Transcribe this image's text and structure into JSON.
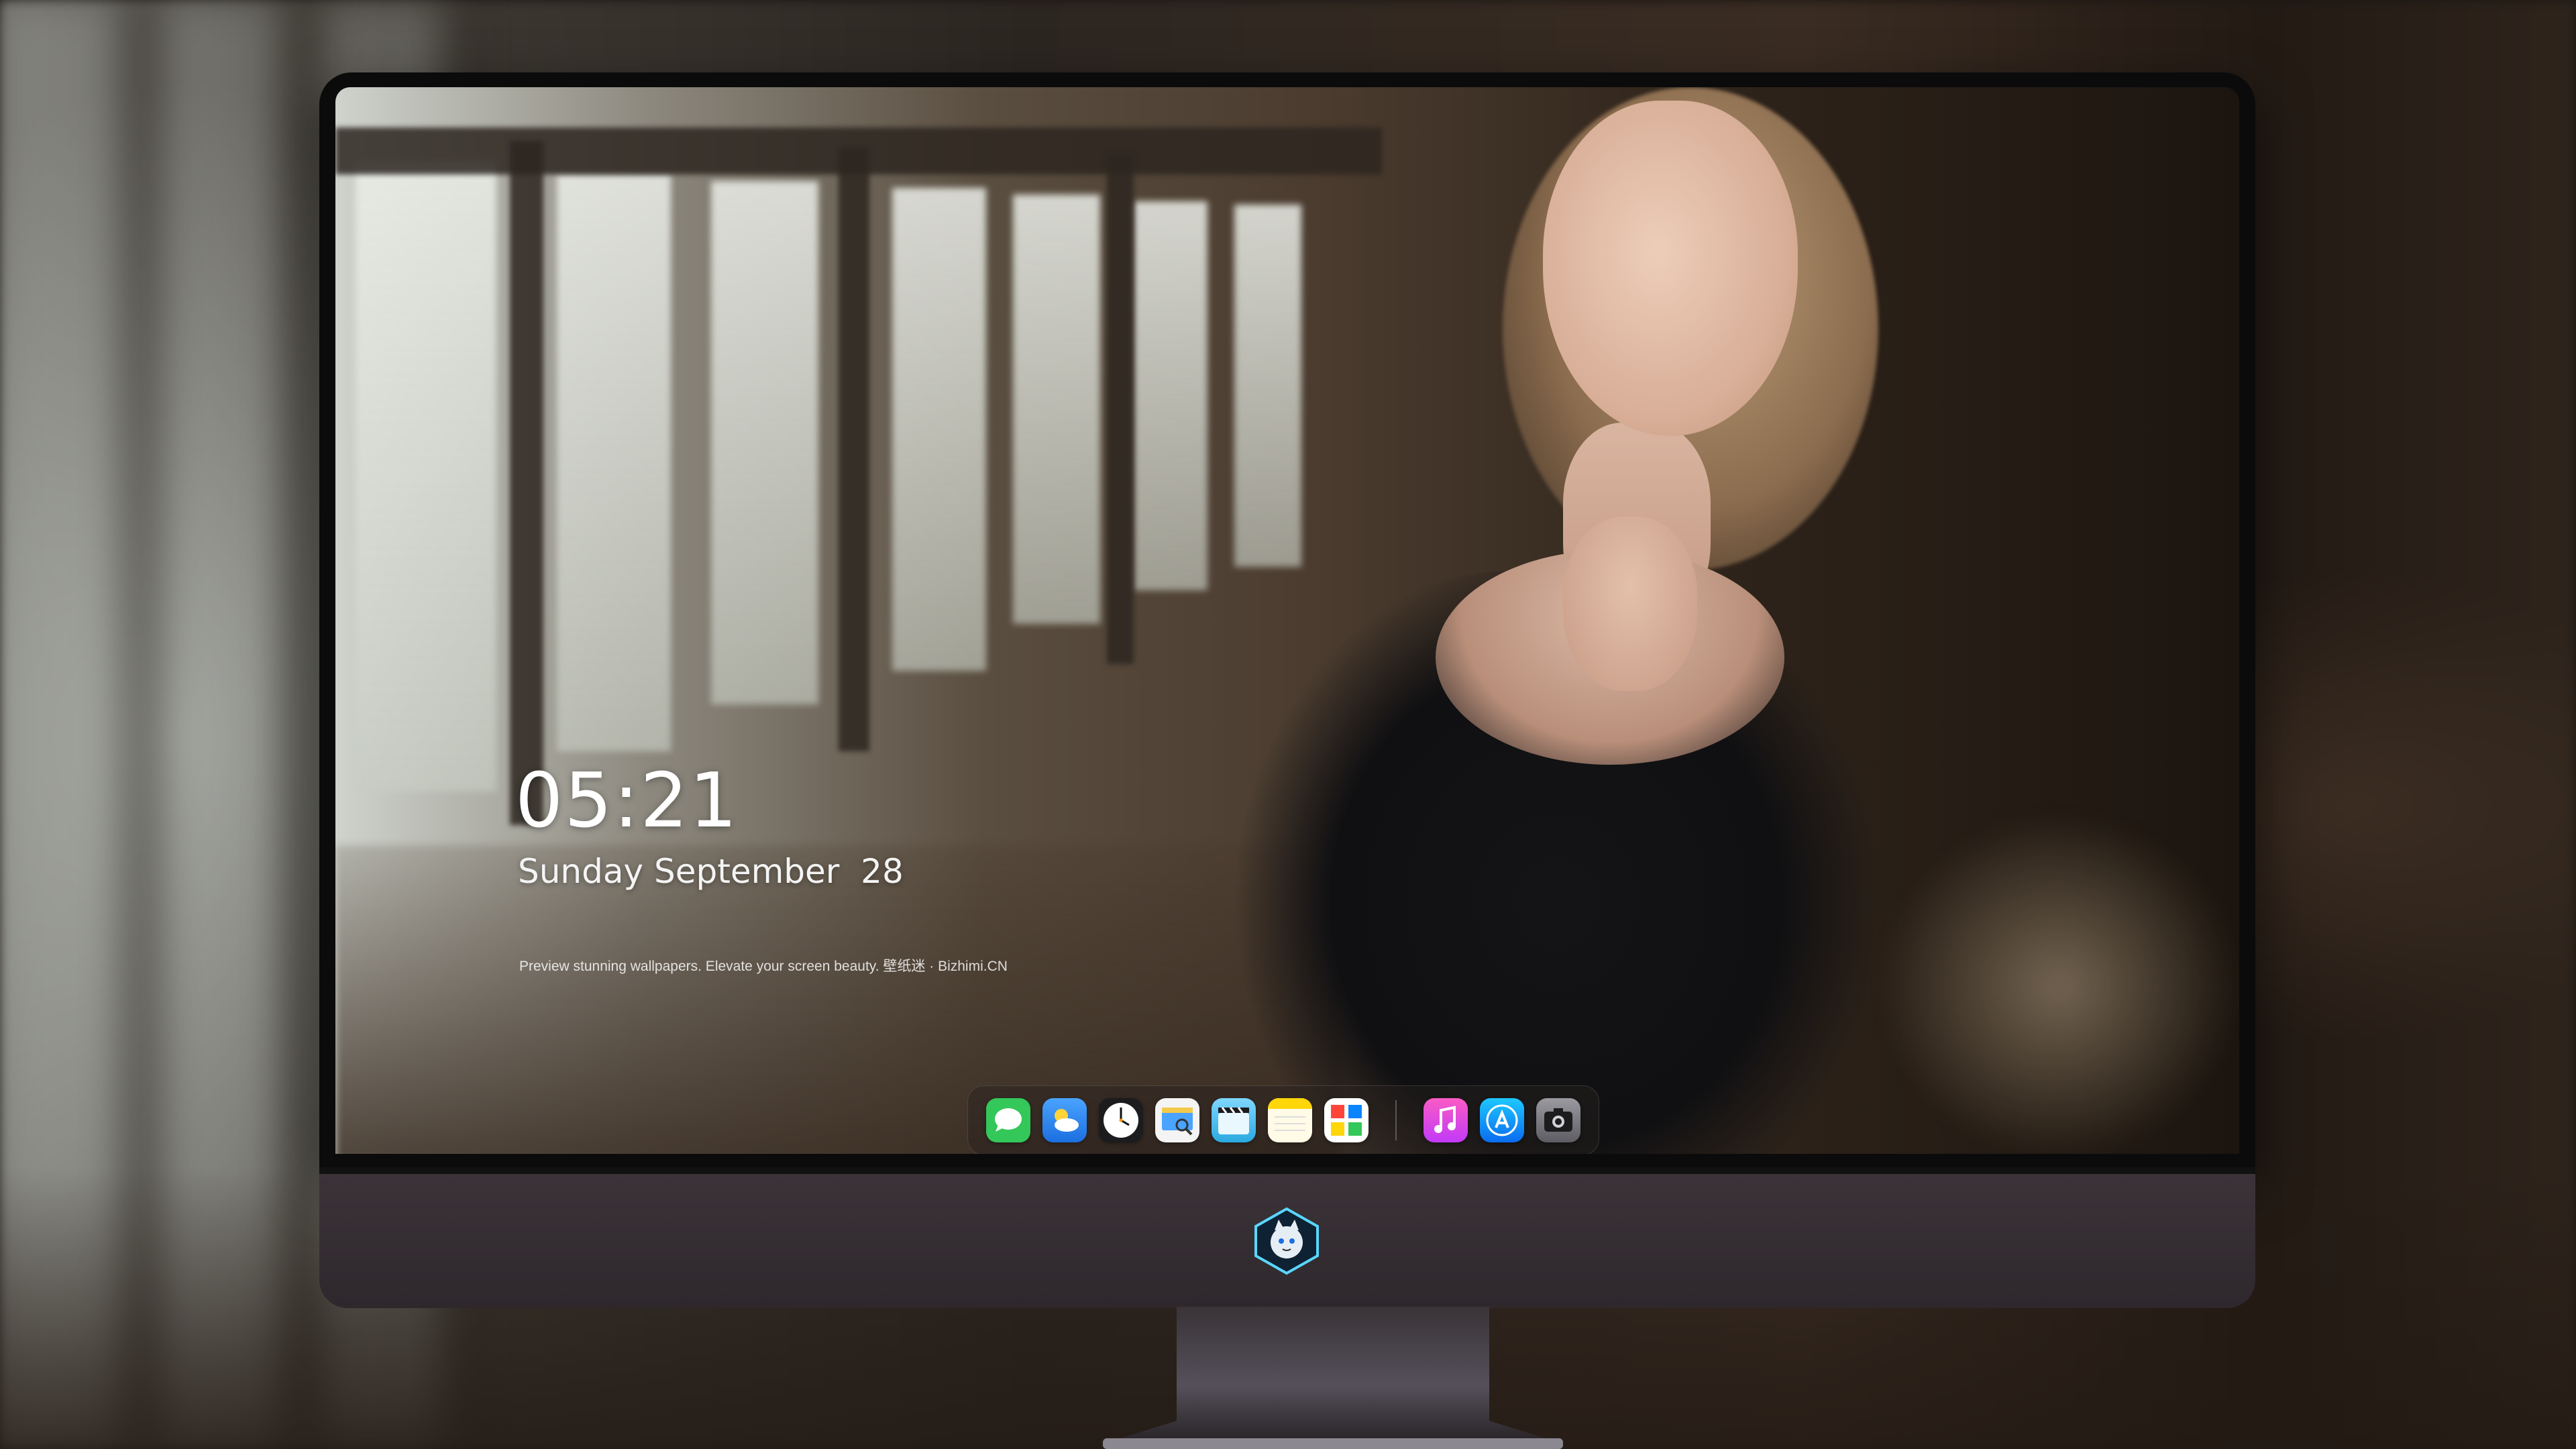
{
  "lock_screen": {
    "time": "05:21",
    "date": "Sunday September  28",
    "tagline": "Preview stunning wallpapers. Elevate your screen beauty. 壁纸迷 · Bizhimi.CN"
  },
  "dock": {
    "apps": [
      {
        "name": "messages-icon",
        "color": "#34c759"
      },
      {
        "name": "weather-icon",
        "color": "#2f8bf5"
      },
      {
        "name": "clock-icon",
        "color": "#1c1c1e"
      },
      {
        "name": "preview-icon",
        "color": "#f2c94c"
      },
      {
        "name": "clips-icon",
        "color": "#5ac8fa"
      },
      {
        "name": "notes-icon",
        "color": "#ffd60a"
      },
      {
        "name": "photos-gallery-icon",
        "color": "#ff9f0a"
      },
      {
        "name": "music-icon",
        "color": "#d63af9"
      },
      {
        "name": "app-store-icon",
        "color": "#0a84ff"
      },
      {
        "name": "camera-icon",
        "color": "#8e8e93"
      }
    ]
  },
  "monitor": {
    "chin_logo": "bizhimi-logo-icon"
  }
}
